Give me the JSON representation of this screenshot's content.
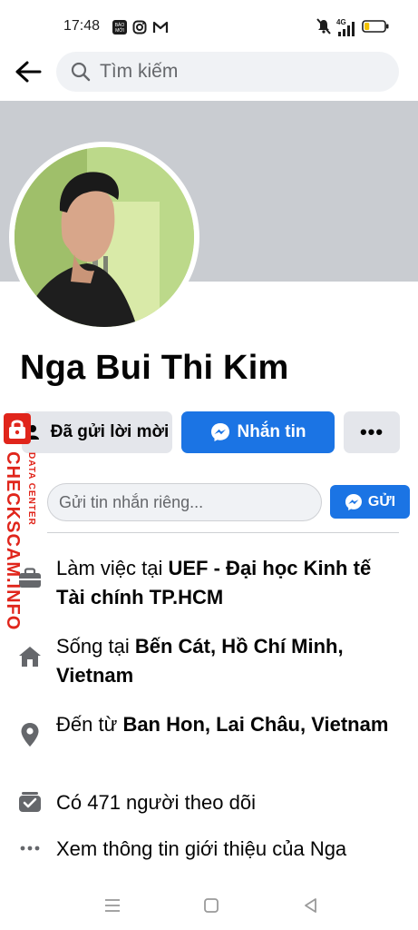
{
  "status_bar": {
    "time": "17:48",
    "network": "4G",
    "battery_level": 0.25,
    "icons": [
      "baomoi-icon",
      "instagram-icon",
      "gmail-icon",
      "mute-icon",
      "signal-icon",
      "battery-icon"
    ]
  },
  "search": {
    "placeholder": "Tìm kiếm"
  },
  "profile": {
    "name": "Nga Bui Thi Kim"
  },
  "actions": {
    "request_label": "Đã gửi lời mời",
    "message_label": "Nhắn tin",
    "more_label": "•••"
  },
  "private_message": {
    "placeholder": "Gửi tin nhắn riêng...",
    "send_label": "GỬI"
  },
  "info": {
    "work": {
      "prefix": "Làm việc tại ",
      "bold": "UEF - Đại học Kinh tế Tài chính TP.HCM"
    },
    "lives": {
      "prefix": "Sống tại ",
      "bold": "Bến Cát, Hồ Chí Minh, Vietnam"
    },
    "from": {
      "prefix": "Đến từ ",
      "bold": "Ban Hon, Lai Châu, Vietnam"
    },
    "followers": "Có 471 người theo dõi",
    "about": "Xem thông tin giới thiệu của Nga"
  },
  "watermark": {
    "brand": "CHECKSCAM.INFO",
    "sub": "DATA CENTER"
  },
  "colors": {
    "accent": "#1b74e4",
    "watermark": "#e0251b",
    "cover": "#c9ccd1"
  }
}
